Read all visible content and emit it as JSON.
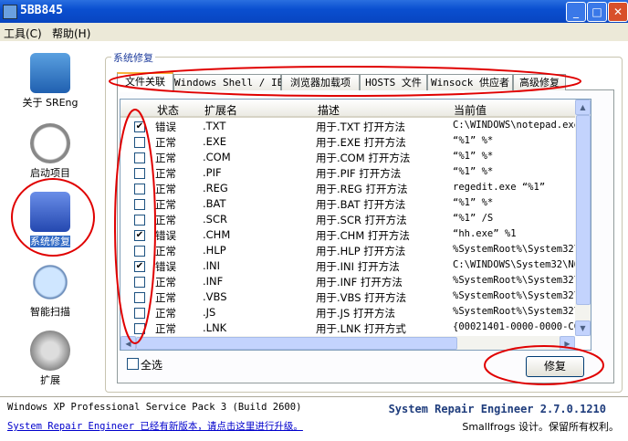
{
  "window": {
    "title": "5BB845",
    "controls": [
      "minimize",
      "maximize",
      "close"
    ]
  },
  "menu": [
    "工具(C)",
    "帮助(H)"
  ],
  "sidebar": [
    {
      "label": "关于 SREng",
      "icon": "tools-icon"
    },
    {
      "label": "启动项目",
      "icon": "clock-icon"
    },
    {
      "label": "系统修复",
      "icon": "checklist-icon",
      "selected": true
    },
    {
      "label": "智能扫描",
      "icon": "magnifier-icon"
    },
    {
      "label": "扩展",
      "icon": "gear-plus-icon"
    }
  ],
  "group_title": "系统修复",
  "tabs": [
    "文件关联",
    "Windows Shell / IE",
    "浏览器加载项",
    "HOSTS 文件",
    "Winsock 供应者",
    "高级修复"
  ],
  "active_tab": 0,
  "columns": [
    "状态",
    "扩展名",
    "描述",
    "当前值"
  ],
  "rows": [
    {
      "checked": true,
      "status": "错误",
      "ext": ".TXT",
      "desc": "用于.TXT 打开方法",
      "value": "C:\\WINDOWS\\notepad.exe"
    },
    {
      "checked": false,
      "status": "正常",
      "ext": ".EXE",
      "desc": "用于.EXE 打开方法",
      "value": "“%1” %*"
    },
    {
      "checked": false,
      "status": "正常",
      "ext": ".COM",
      "desc": "用于.COM 打开方法",
      "value": "“%1” %*"
    },
    {
      "checked": false,
      "status": "正常",
      "ext": ".PIF",
      "desc": "用于.PIF 打开方法",
      "value": "“%1” %*"
    },
    {
      "checked": false,
      "status": "正常",
      "ext": ".REG",
      "desc": "用于.REG 打开方法",
      "value": "regedit.exe “%1”"
    },
    {
      "checked": false,
      "status": "正常",
      "ext": ".BAT",
      "desc": "用于.BAT 打开方法",
      "value": "“%1” %*"
    },
    {
      "checked": false,
      "status": "正常",
      "ext": ".SCR",
      "desc": "用于.SCR 打开方法",
      "value": "“%1” /S"
    },
    {
      "checked": true,
      "status": "错误",
      "ext": ".CHM",
      "desc": "用于.CHM 打开方法",
      "value": "“hh.exe” %1"
    },
    {
      "checked": false,
      "status": "正常",
      "ext": ".HLP",
      "desc": "用于.HLP 打开方法",
      "value": "%SystemRoot%\\System32\\"
    },
    {
      "checked": true,
      "status": "错误",
      "ext": ".INI",
      "desc": "用于.INI 打开方法",
      "value": "C:\\WINDOWS\\System32\\NO"
    },
    {
      "checked": false,
      "status": "正常",
      "ext": ".INF",
      "desc": "用于.INF 打开方法",
      "value": "%SystemRoot%\\System32\\"
    },
    {
      "checked": false,
      "status": "正常",
      "ext": ".VBS",
      "desc": "用于.VBS 打开方法",
      "value": "%SystemRoot%\\System32\\"
    },
    {
      "checked": false,
      "status": "正常",
      "ext": ".JS",
      "desc": "用于.JS 打开方法",
      "value": "%SystemRoot%\\System32\\"
    },
    {
      "checked": false,
      "status": "正常",
      "ext": ".LNK",
      "desc": "用于.LNK 打开方式",
      "value": "{00021401-0000-0000-C0"
    }
  ],
  "select_all": "全选",
  "repair_button": "修复",
  "status": {
    "os": "Windows XP Professional Service Pack 3 (Build 2600)",
    "update_link": "System Repair Engineer 已经有新版本，请点击这里进行升级。",
    "version": "System Repair Engineer 2.7.0.1210",
    "copyright": "Smallfrogs 设计。保留所有权利。"
  },
  "colors": {
    "titlebar": "#0a4fd0",
    "annotation": "#e00000",
    "link": "#0000cc"
  }
}
